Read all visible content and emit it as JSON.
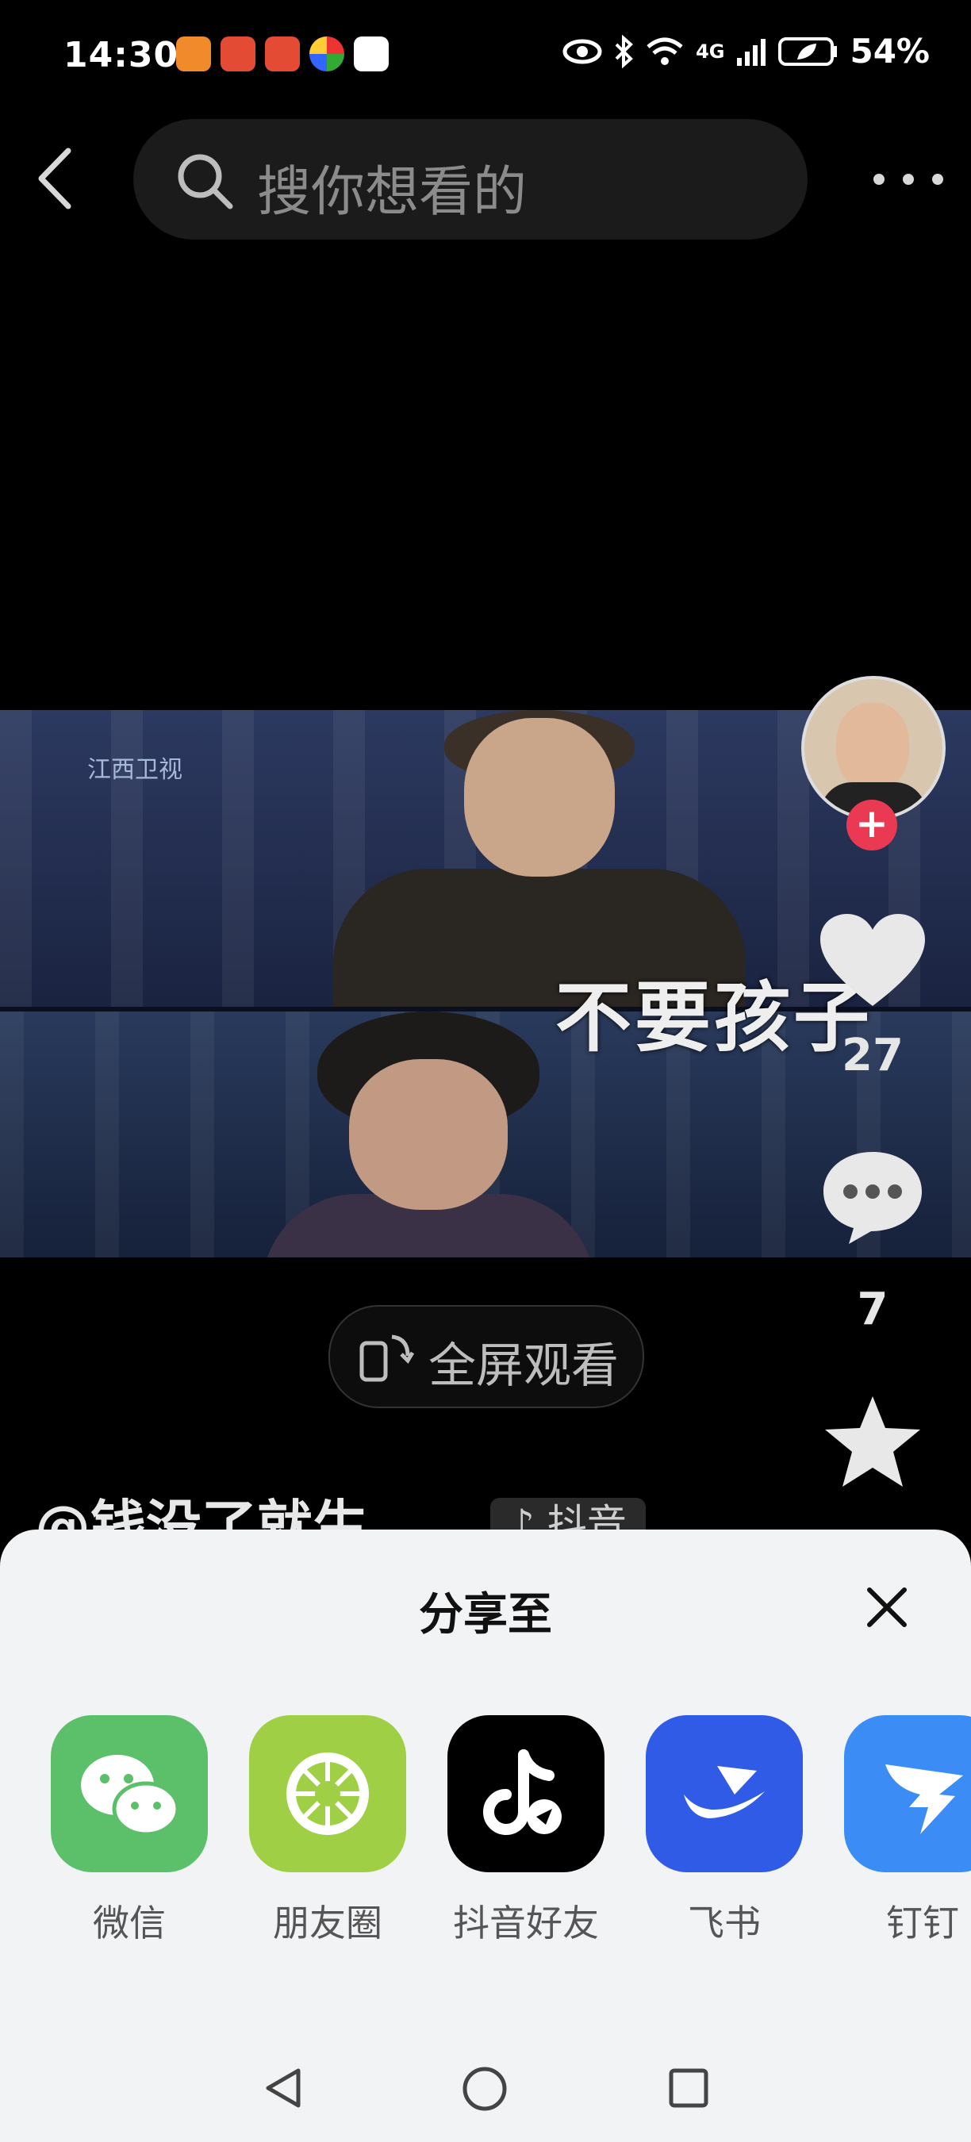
{
  "status_bar": {
    "time": "14:30",
    "network": "4G",
    "battery": "54%"
  },
  "search": {
    "placeholder": "搜你想看的"
  },
  "video": {
    "caption": "不要孩子",
    "channel_watermark": "江西卫视",
    "fullscreen_label": "全屏观看"
  },
  "right_rail": {
    "like_count": "27",
    "comment_count": "7"
  },
  "author": {
    "name": "@钱没了就生",
    "badge": "抖音"
  },
  "share_sheet": {
    "title": "分享至",
    "targets": [
      {
        "label": "微信",
        "icon": "wechat-icon",
        "color": "#5cbf6a"
      },
      {
        "label": "朋友圈",
        "icon": "moments-icon",
        "color": "#9fcf45"
      },
      {
        "label": "抖音好友",
        "icon": "douyin-icon",
        "color": "#000000"
      },
      {
        "label": "飞书",
        "icon": "feishu-icon",
        "color": "#2f5be7"
      },
      {
        "label": "钉钉",
        "icon": "dingtalk-icon",
        "color": "#3c8cf5"
      }
    ]
  },
  "colors": {
    "accent_red": "#ea3a53",
    "sheet_bg": "#f2f3f5"
  }
}
